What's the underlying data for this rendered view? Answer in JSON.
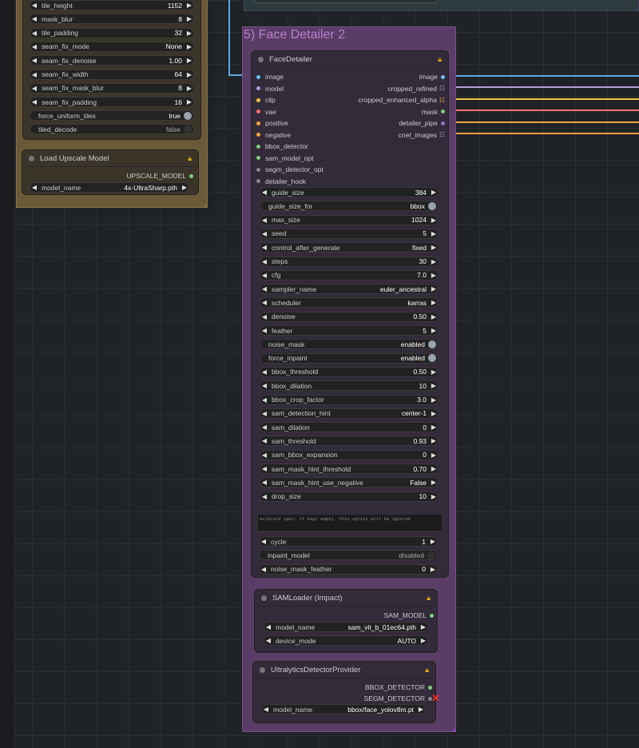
{
  "colors": {
    "image": "#6ec3f5",
    "model": "#b39ddb",
    "clip": "#f6c445",
    "vae": "#ff6f6f",
    "conditioning": "#ffa040",
    "bbox": "#7fd07f",
    "sam": "#7fd07f",
    "segm": "#888888",
    "hook": "#888888",
    "mask": "#81c784",
    "detailer_pipe": "#9575cd",
    "wire_blue": "#5aa9e6"
  },
  "upscale_widgets": [
    {
      "label": "tile_height",
      "value": "1152"
    },
    {
      "label": "mask_blur",
      "value": "8"
    },
    {
      "label": "tile_padding",
      "value": "32"
    },
    {
      "label": "seam_fix_mode",
      "value": "None"
    },
    {
      "label": "seam_fix_denoise",
      "value": "1.00"
    },
    {
      "label": "seam_fix_width",
      "value": "64"
    },
    {
      "label": "seam_fix_mask_blur",
      "value": "8"
    },
    {
      "label": "seam_fix_padding",
      "value": "16"
    }
  ],
  "upscale_toggles": [
    {
      "label": "force_uniform_tiles",
      "value": "true"
    },
    {
      "label": "tiled_decode",
      "value": "false"
    }
  ],
  "load_upscale": {
    "title": "Load Upscale Model",
    "output": "UPSCALE_MODEL",
    "widget_label": "model_name",
    "widget_value": "4x-UltraSharp.pth"
  },
  "group": {
    "title": "5) Face Detailer 2"
  },
  "face_detailer": {
    "title": "FaceDetailer",
    "inputs": [
      "image",
      "model",
      "clip",
      "vae",
      "positive",
      "negative",
      "bbox_detector",
      "sam_model_opt",
      "segm_detector_opt",
      "detailer_hook"
    ],
    "outputs": [
      "image",
      "cropped_refined",
      "cropped_enhanced_alpha",
      "mask",
      "detailer_pipe",
      "cnet_images"
    ],
    "widgets": [
      {
        "label": "guide_size",
        "value": "384",
        "type": "num"
      },
      {
        "label": "guide_size_for",
        "value": "bbox",
        "type": "tog"
      },
      {
        "label": "max_size",
        "value": "1024",
        "type": "num"
      },
      {
        "label": "seed",
        "value": "5",
        "type": "num"
      },
      {
        "label": "control_after_generate",
        "value": "fixed",
        "type": "num"
      },
      {
        "label": "steps",
        "value": "30",
        "type": "num"
      },
      {
        "label": "cfg",
        "value": "7.0",
        "type": "num"
      },
      {
        "label": "sampler_name",
        "value": "euler_ancestral",
        "type": "num"
      },
      {
        "label": "scheduler",
        "value": "karras",
        "type": "num"
      },
      {
        "label": "denoise",
        "value": "0.50",
        "type": "num"
      },
      {
        "label": "feather",
        "value": "5",
        "type": "num"
      },
      {
        "label": "noise_mask",
        "value": "enabled",
        "type": "tog"
      },
      {
        "label": "force_inpaint",
        "value": "enabled",
        "type": "tog"
      },
      {
        "label": "bbox_threshold",
        "value": "0.50",
        "type": "num"
      },
      {
        "label": "bbox_dilation",
        "value": "10",
        "type": "num"
      },
      {
        "label": "bbox_crop_factor",
        "value": "3.0",
        "type": "num"
      },
      {
        "label": "sam_detection_hint",
        "value": "center-1",
        "type": "num"
      },
      {
        "label": "sam_dilation",
        "value": "0",
        "type": "num"
      },
      {
        "label": "sam_threshold",
        "value": "0.93",
        "type": "num"
      },
      {
        "label": "sam_bbox_expansion",
        "value": "0",
        "type": "num"
      },
      {
        "label": "sam_mask_hint_threshold",
        "value": "0.70",
        "type": "num"
      },
      {
        "label": "sam_mask_hint_use_negative",
        "value": "False",
        "type": "num"
      },
      {
        "label": "drop_size",
        "value": "10",
        "type": "num"
      }
    ],
    "wildcard_placeholder": "wildcard spec: if kept empty, this option will be ignored",
    "widgets2": [
      {
        "label": "cycle",
        "value": "1",
        "type": "num"
      },
      {
        "label": "inpaint_model",
        "value": "disabled",
        "type": "togoff"
      },
      {
        "label": "noise_mask_feather",
        "value": "0",
        "type": "num"
      }
    ]
  },
  "sam_loader": {
    "title": "SAMLoader (Impact)",
    "output": "SAM_MODEL",
    "widgets": [
      {
        "label": "model_name",
        "value": "sam_vit_b_01ec64.pth"
      },
      {
        "label": "device_mode",
        "value": "AUTO"
      }
    ]
  },
  "ultralytics": {
    "title": "UltralyticsDetectorProvider",
    "outputs": [
      "BBOX_DETECTOR",
      "SEGM_DETECTOR"
    ],
    "widget_label": "model_name",
    "widget_value": "bbox/face_yolov8m.pt"
  }
}
